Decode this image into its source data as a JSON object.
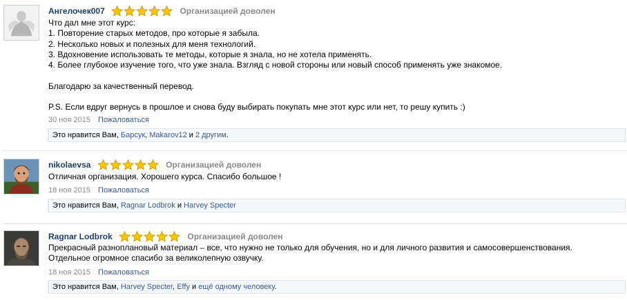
{
  "reviews": [
    {
      "username": "Ангелочек007",
      "rating": 5,
      "verdict": "Организацией доволен",
      "lines": [
        "Что дал мне этот курс:",
        "1. Повторение старых методов, про которые я забыла.",
        "2. Несколько новых и полезных для меня технологий.",
        "3. Вдохновение использовать те методы, которые я знала, но не хотела применять.",
        "4. Более глубокое изучение того, что уже знала. Взгляд с новой стороны или новый способ применять уже знакомое.",
        "",
        "Благодарю за качественный перевод.",
        "",
        "P.S. Если вдруг вернусь в прошлое и снова буду выбирать покупать мне этот курс или нет, то решу купить :)"
      ],
      "date": "30 ноя 2015",
      "report_label": "Пожаловаться",
      "likes": {
        "prefix": "Это нравится Вам,",
        "names": [
          "Барсук",
          "Makarov12"
        ],
        "conj": "и",
        "others": "2 другим",
        "suffix": "."
      }
    },
    {
      "username": "nikolaevsa",
      "rating": 5,
      "verdict": "Организацией доволен",
      "lines": [
        "Отличная организация. Хорошего курса. Спасибо большое !"
      ],
      "date": "18 ноя 2015",
      "report_label": "Пожаловаться",
      "likes": {
        "prefix": "Это нравится Вам,",
        "names": [
          "Ragnar Lodbrok"
        ],
        "conj": "и",
        "others": "Harvey Specter",
        "suffix": ""
      }
    },
    {
      "username": "Ragnar Lodbrok",
      "rating": 5,
      "verdict": "Организацией доволен",
      "lines": [
        "Прекрасный разноплановый материал – все, что нужно не только для обучения, но и для личного развития и самосовершенствования.",
        "Отдельное огромное спасибо за великолепную озвучку."
      ],
      "date": "18 ноя 2015",
      "report_label": "Пожаловаться",
      "likes": {
        "prefix": "Это нравится Вам,",
        "names": [
          "Harvey Specter",
          "Effy"
        ],
        "conj": "и",
        "others": "ещё одному человеку",
        "suffix": "."
      }
    }
  ],
  "colors": {
    "username": "#1f3d6d",
    "link": "#3b5998",
    "muted": "#8a8a8a",
    "star_fill": "#f6c600",
    "star_stroke": "#c99a00"
  },
  "icons": {
    "star": "star-icon",
    "avatar_1": "avatar-angel-figure",
    "avatar_2": "avatar-cartoon-viking",
    "avatar_3": "avatar-bearded-man"
  }
}
